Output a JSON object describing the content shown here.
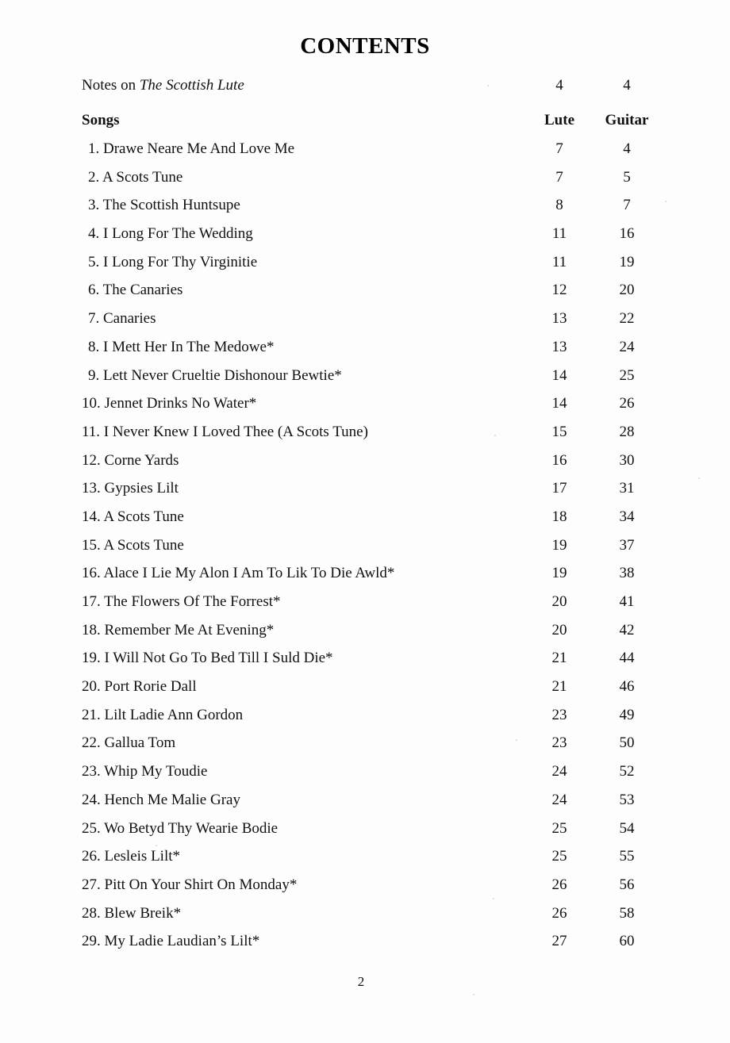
{
  "document": {
    "title": "CONTENTS",
    "page_number": "2"
  },
  "columns": {
    "lute_header": "Lute",
    "guitar_header": "Guitar"
  },
  "notes_row": {
    "label_prefix": "Notes on ",
    "label_italic": "The Scottish Lute",
    "lute": "4",
    "guitar": "4"
  },
  "songs_heading": {
    "label": "Songs"
  },
  "entries": [
    {
      "label": "1. Drawe Neare Me And Love Me",
      "lute": "7",
      "guitar": "4"
    },
    {
      "label": "2. A Scots Tune",
      "lute": "7",
      "guitar": "5"
    },
    {
      "label": "3. The Scottish Huntsupe",
      "lute": "8",
      "guitar": "7"
    },
    {
      "label": "4. I Long For The Wedding",
      "lute": "11",
      "guitar": "16"
    },
    {
      "label": "5. I Long For Thy Virginitie",
      "lute": "11",
      "guitar": "19"
    },
    {
      "label": "6. The Canaries",
      "lute": "12",
      "guitar": "20"
    },
    {
      "label": "7. Canaries",
      "lute": "13",
      "guitar": "22"
    },
    {
      "label": "8. I Mett Her In The Medowe*",
      "lute": "13",
      "guitar": "24"
    },
    {
      "label": "9. Lett Never Crueltie Dishonour Bewtie*",
      "lute": "14",
      "guitar": "25"
    },
    {
      "label": "10. Jennet Drinks No Water*",
      "lute": "14",
      "guitar": "26"
    },
    {
      "label": "11. I Never Knew I Loved Thee (A Scots Tune)",
      "lute": "15",
      "guitar": "28"
    },
    {
      "label": "12. Corne Yards",
      "lute": "16",
      "guitar": "30"
    },
    {
      "label": "13. Gypsies Lilt",
      "lute": "17",
      "guitar": "31"
    },
    {
      "label": "14. A Scots Tune",
      "lute": "18",
      "guitar": "34"
    },
    {
      "label": "15. A Scots Tune",
      "lute": "19",
      "guitar": "37"
    },
    {
      "label": "16. Alace I Lie My Alon I Am To Lik To Die Awld*",
      "lute": "19",
      "guitar": "38"
    },
    {
      "label": "17. The Flowers Of The Forrest*",
      "lute": "20",
      "guitar": "41"
    },
    {
      "label": "18. Remember Me At Evening*",
      "lute": "20",
      "guitar": "42"
    },
    {
      "label": "19. I Will Not Go To Bed Till I Suld Die*",
      "lute": "21",
      "guitar": "44"
    },
    {
      "label": "20. Port Rorie Dall",
      "lute": "21",
      "guitar": "46"
    },
    {
      "label": "21. Lilt Ladie Ann Gordon",
      "lute": "23",
      "guitar": "49"
    },
    {
      "label": "22. Gallua Tom",
      "lute": "23",
      "guitar": "50"
    },
    {
      "label": "23. Whip My Toudie",
      "lute": "24",
      "guitar": "52"
    },
    {
      "label": "24. Hench Me Malie Gray",
      "lute": "24",
      "guitar": "53"
    },
    {
      "label": "25. Wo Betyd Thy Wearie Bodie",
      "lute": "25",
      "guitar": "54"
    },
    {
      "label": "26. Lesleis Lilt*",
      "lute": "25",
      "guitar": "55"
    },
    {
      "label": "27. Pitt On Your Shirt On Monday*",
      "lute": "26",
      "guitar": "56"
    },
    {
      "label": "28. Blew Breik*",
      "lute": "26",
      "guitar": "58"
    },
    {
      "label": "29. My Ladie Laudian’s Lilt*",
      "lute": "27",
      "guitar": "60"
    }
  ]
}
